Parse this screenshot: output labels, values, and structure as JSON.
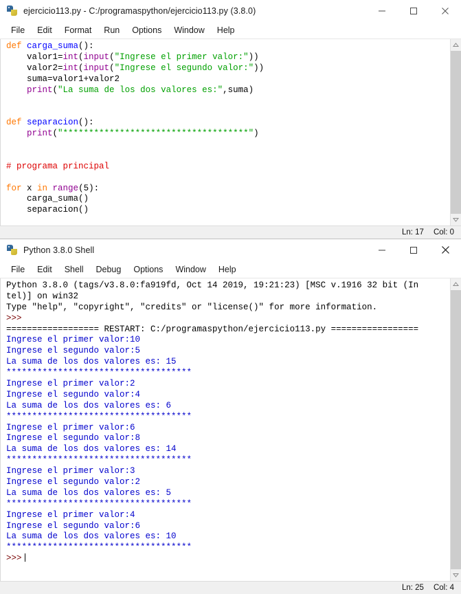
{
  "editor": {
    "title": "ejercicio113.py - C:/programaspython/ejercicio113.py (3.8.0)",
    "icon": "python-logo-icon",
    "menus": [
      "File",
      "Edit",
      "Format",
      "Run",
      "Options",
      "Window",
      "Help"
    ],
    "window_controls": [
      "minimize",
      "maximize",
      "close"
    ],
    "status": {
      "line": "Ln: 17",
      "col": "Col: 0"
    },
    "code_lines": [
      [
        {
          "t": "def ",
          "c": "kw"
        },
        {
          "t": "carga_suma",
          "c": "def"
        },
        {
          "t": "():",
          "c": "pl"
        }
      ],
      [
        {
          "t": "    valor1=",
          "c": "pl"
        },
        {
          "t": "int",
          "c": "bi"
        },
        {
          "t": "(",
          "c": "pl"
        },
        {
          "t": "input",
          "c": "bi"
        },
        {
          "t": "(",
          "c": "pl"
        },
        {
          "t": "\"Ingrese el primer valor:\"",
          "c": "str"
        },
        {
          "t": "))",
          "c": "pl"
        }
      ],
      [
        {
          "t": "    valor2=",
          "c": "pl"
        },
        {
          "t": "int",
          "c": "bi"
        },
        {
          "t": "(",
          "c": "pl"
        },
        {
          "t": "input",
          "c": "bi"
        },
        {
          "t": "(",
          "c": "pl"
        },
        {
          "t": "\"Ingrese el segundo valor:\"",
          "c": "str"
        },
        {
          "t": "))",
          "c": "pl"
        }
      ],
      [
        {
          "t": "    suma=valor1+valor2",
          "c": "pl"
        }
      ],
      [
        {
          "t": "    ",
          "c": "pl"
        },
        {
          "t": "print",
          "c": "bi"
        },
        {
          "t": "(",
          "c": "pl"
        },
        {
          "t": "\"La suma de los dos valores es:\"",
          "c": "str"
        },
        {
          "t": ",suma)",
          "c": "pl"
        }
      ],
      [
        {
          "t": "",
          "c": "pl"
        }
      ],
      [
        {
          "t": "",
          "c": "pl"
        }
      ],
      [
        {
          "t": "def ",
          "c": "kw"
        },
        {
          "t": "separacion",
          "c": "def"
        },
        {
          "t": "():",
          "c": "pl"
        }
      ],
      [
        {
          "t": "    ",
          "c": "pl"
        },
        {
          "t": "print",
          "c": "bi"
        },
        {
          "t": "(",
          "c": "pl"
        },
        {
          "t": "\"************************************\"",
          "c": "str"
        },
        {
          "t": ")",
          "c": "pl"
        }
      ],
      [
        {
          "t": "",
          "c": "pl"
        }
      ],
      [
        {
          "t": "",
          "c": "pl"
        }
      ],
      [
        {
          "t": "# programa principal",
          "c": "cmt"
        }
      ],
      [
        {
          "t": "",
          "c": "pl"
        }
      ],
      [
        {
          "t": "for ",
          "c": "kw"
        },
        {
          "t": "x ",
          "c": "pl"
        },
        {
          "t": "in ",
          "c": "kw"
        },
        {
          "t": "range",
          "c": "bi"
        },
        {
          "t": "(5):",
          "c": "pl"
        }
      ],
      [
        {
          "t": "    carga_suma()",
          "c": "pl"
        }
      ],
      [
        {
          "t": "    separacion()",
          "c": "pl"
        }
      ]
    ]
  },
  "shell": {
    "title": "Python 3.8.0 Shell",
    "icon": "python-logo-icon",
    "menus": [
      "File",
      "Edit",
      "Shell",
      "Debug",
      "Options",
      "Window",
      "Help"
    ],
    "window_controls": [
      "minimize",
      "maximize",
      "close"
    ],
    "status": {
      "line": "Ln: 25",
      "col": "Col: 4"
    },
    "lines": [
      [
        {
          "t": "Python 3.8.0 (tags/v3.8.0:fa919fd, Oct 14 2019, 19:21:23) [MSC v.1916 32 bit (In",
          "c": "pl"
        }
      ],
      [
        {
          "t": "tel)] on win32",
          "c": "pl"
        }
      ],
      [
        {
          "t": "Type \"help\", \"copyright\", \"credits\" or \"license()\" for more information.",
          "c": "pl"
        }
      ],
      [
        {
          "t": ">>> ",
          "c": "prm"
        }
      ],
      [
        {
          "t": "================== RESTART: C:/programaspython/ejercicio113.py =================",
          "c": "pl"
        }
      ],
      [
        {
          "t": "Ingrese el primer valor:10",
          "c": "out"
        }
      ],
      [
        {
          "t": "Ingrese el segundo valor:5",
          "c": "out"
        }
      ],
      [
        {
          "t": "La suma de los dos valores es: 15",
          "c": "out"
        }
      ],
      [
        {
          "t": "************************************",
          "c": "out"
        }
      ],
      [
        {
          "t": "Ingrese el primer valor:2",
          "c": "out"
        }
      ],
      [
        {
          "t": "Ingrese el segundo valor:4",
          "c": "out"
        }
      ],
      [
        {
          "t": "La suma de los dos valores es: 6",
          "c": "out"
        }
      ],
      [
        {
          "t": "************************************",
          "c": "out"
        }
      ],
      [
        {
          "t": "Ingrese el primer valor:6",
          "c": "out"
        }
      ],
      [
        {
          "t": "Ingrese el segundo valor:8",
          "c": "out"
        }
      ],
      [
        {
          "t": "La suma de los dos valores es: 14",
          "c": "out"
        }
      ],
      [
        {
          "t": "************************************",
          "c": "out"
        }
      ],
      [
        {
          "t": "Ingrese el primer valor:3",
          "c": "out"
        }
      ],
      [
        {
          "t": "Ingrese el segundo valor:2",
          "c": "out"
        }
      ],
      [
        {
          "t": "La suma de los dos valores es: 5",
          "c": "out"
        }
      ],
      [
        {
          "t": "************************************",
          "c": "out"
        }
      ],
      [
        {
          "t": "Ingrese el primer valor:4",
          "c": "out"
        }
      ],
      [
        {
          "t": "Ingrese el segundo valor:6",
          "c": "out"
        }
      ],
      [
        {
          "t": "La suma de los dos valores es: 10",
          "c": "out"
        }
      ],
      [
        {
          "t": "************************************",
          "c": "out"
        }
      ]
    ],
    "prompt": ">>>"
  },
  "colors": {
    "keyword": "#ff7700",
    "definition": "#0000ff",
    "string": "#00a000",
    "builtin": "#900090",
    "comment": "#dd0000",
    "output": "#0000cc",
    "prompt": "#770000"
  }
}
